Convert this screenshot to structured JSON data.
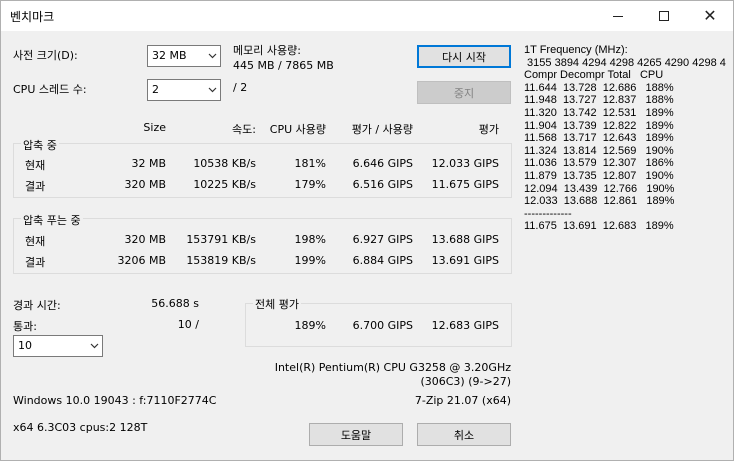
{
  "window": {
    "title": "벤치마크",
    "minimize_label": "—",
    "maximize_label": "☐",
    "close_label": "✕"
  },
  "settings": {
    "dict_label": "사전 크기(D):",
    "dict_value": "32 MB",
    "threads_label": "CPU 스레드 수:",
    "threads_value": "2",
    "threads_total": "/ 2",
    "memory_label": "메모리 사용량:",
    "memory_value": "445 MB / 7865 MB",
    "passes_value": "10"
  },
  "buttons": {
    "restart": "다시 시작",
    "stop": "중지",
    "help": "도움말",
    "cancel": "취소"
  },
  "headers": {
    "size": "Size",
    "speed": "속도:",
    "cpu_usage": "CPU 사용량",
    "rating_usage": "평가 / 사용량",
    "rating": "평가"
  },
  "compress": {
    "label": "압축 중",
    "rows": [
      {
        "name": "현재",
        "size": "32 MB",
        "speed": "10538 KB/s",
        "cpu": "181%",
        "rpu": "6.646 GIPS",
        "rating": "12.033 GIPS"
      },
      {
        "name": "결과",
        "size": "320 MB",
        "speed": "10225 KB/s",
        "cpu": "179%",
        "rpu": "6.516 GIPS",
        "rating": "11.675 GIPS"
      }
    ]
  },
  "decompress": {
    "label": "압축 푸는 중",
    "rows": [
      {
        "name": "현재",
        "size": "320 MB",
        "speed": "153791 KB/s",
        "cpu": "198%",
        "rpu": "6.927 GIPS",
        "rating": "13.688 GIPS"
      },
      {
        "name": "결과",
        "size": "3206 MB",
        "speed": "153819 KB/s",
        "cpu": "199%",
        "rpu": "6.884 GIPS",
        "rating": "13.691 GIPS"
      }
    ]
  },
  "elapsed": {
    "label": "경과 시간:",
    "value": "56.688 s",
    "passes_label": "통과:",
    "passes_value": "10 /"
  },
  "total": {
    "label": "전체 평가",
    "cpu": "189%",
    "rpu": "6.700 GIPS",
    "rating": "12.683 GIPS"
  },
  "system": {
    "cpu_line1": "Intel(R) Pentium(R) CPU G3258 @ 3.20GHz",
    "cpu_line2": "(306C3) (9->27)",
    "os": "Windows 10.0 19043 : f:7110F2774C",
    "zip_version": "7-Zip 21.07 (x64)",
    "arch": "x64 6.3C03 cpus:2 128T"
  },
  "log": [
    "1T Frequency (MHz):",
    " 3155 3894 4294 4298 4265 4290 4298 4",
    "Compr Decompr Total   CPU",
    "11.644  13.728  12.686   188%",
    "11.948  13.727  12.837   188%",
    "11.320  13.742  12.531   189%",
    "11.904  13.739  12.822   189%",
    "11.568  13.717  12.643   189%",
    "11.324  13.814  12.569   190%",
    "11.036  13.579  12.307   186%",
    "11.879  13.735  12.807   190%",
    "12.094  13.439  12.766   190%",
    "12.033  13.688  12.861   189%",
    "-------------",
    "11.675  13.691  12.683   189%"
  ]
}
